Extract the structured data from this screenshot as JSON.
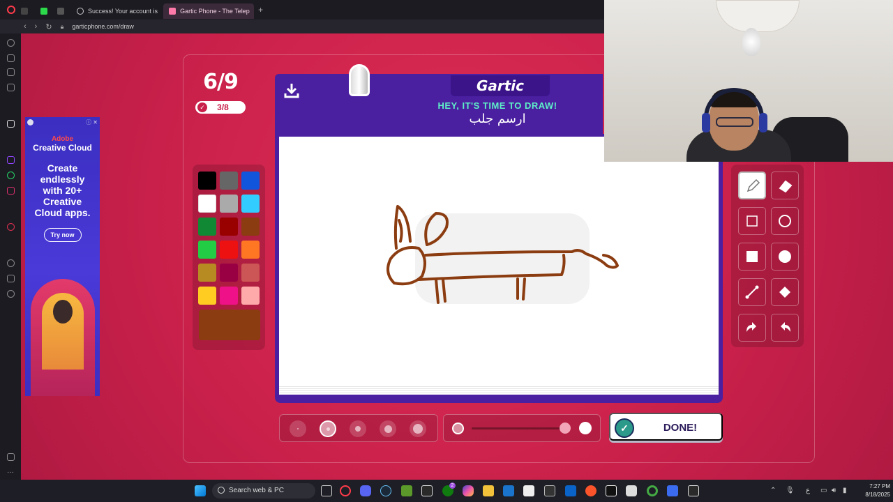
{
  "browser": {
    "tabs": [
      {
        "label": "",
        "icon_color": "#2bd94a"
      },
      {
        "label": "",
        "icon_color": "#cccccc"
      },
      {
        "label": "Success! Your account is",
        "icon_color": "#dddddd"
      },
      {
        "label": "Gartic Phone - The Telep",
        "icon_color": "#ff7aa8"
      }
    ],
    "url": "garticphone.com/draw",
    "new_tab_label": "+"
  },
  "ad": {
    "brand_top": "Adobe",
    "brand_product": "Creative Cloud",
    "headline": "Create endlessly with 20+ Creative Cloud apps.",
    "cta": "Try now"
  },
  "game": {
    "round": "6/9",
    "players_done": "3/8",
    "logo": "Gartic",
    "prompt_header": "HEY, IT'S TIME TO DRAW!",
    "prompt_word": "ارسم جلب",
    "done_label": "DONE!",
    "selected_color": "#8b3c10",
    "palette": [
      "#000000",
      "#666666",
      "#1155dd",
      "#ffffff",
      "#aaaaaa",
      "#33ccff",
      "#118833",
      "#990000",
      "#8b3c10",
      "#22cc44",
      "#ee1111",
      "#ff7722",
      "#b88a22",
      "#990044",
      "#cc5555",
      "#ffcc22",
      "#ee1188",
      "#ffaaaa"
    ],
    "tools": [
      "pencil-icon",
      "eraser-icon",
      "rect-outline-icon",
      "circle-outline-icon",
      "rect-filled-icon",
      "circle-filled-icon",
      "line-icon",
      "fill-icon",
      "undo-icon",
      "redo-icon"
    ],
    "brush_selected": 2
  },
  "taskbar": {
    "search_label": "Search web & PC",
    "time": "7:27 PM",
    "date": "8/18/2025",
    "lang": "ع",
    "tray_badge": "2"
  }
}
